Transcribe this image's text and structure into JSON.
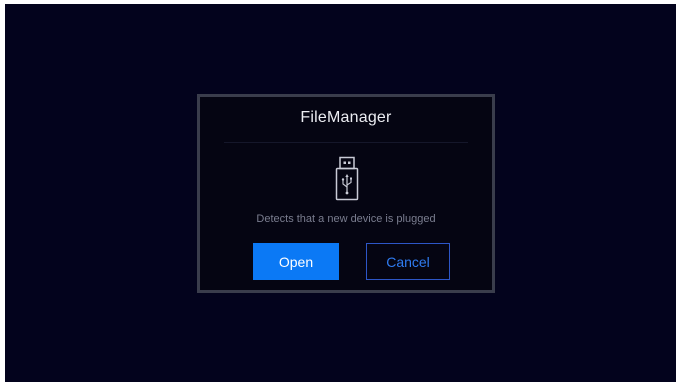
{
  "dialog": {
    "title": "FileManager",
    "message": "Detects that a new device is plugged",
    "icon": "usb-drive-icon",
    "open_label": "Open",
    "cancel_label": "Cancel"
  },
  "colors": {
    "screen_background": "#03031d",
    "dialog_background": "#050512",
    "dialog_border": "#3a3d4c",
    "primary_button": "#0b79f5",
    "secondary_button_text": "#2f7bf0"
  }
}
